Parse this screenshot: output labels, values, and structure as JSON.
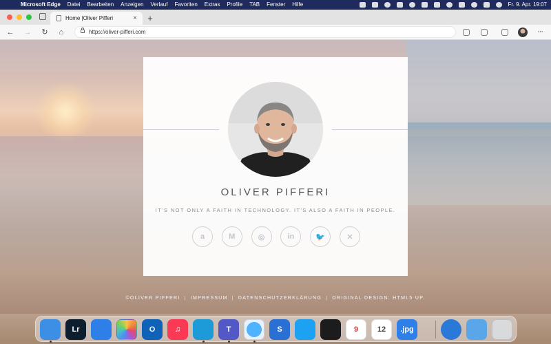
{
  "menubar": {
    "app_name": "Microsoft Edge",
    "items": [
      "Datei",
      "Bearbeiten",
      "Anzeigen",
      "Verlauf",
      "Favoriten",
      "Extras",
      "Profile",
      "TAB",
      "Fenster",
      "Hilfe"
    ],
    "clock": "Fr. 9. Apr.  19:07"
  },
  "browser": {
    "tab_title": "Home |Oliver Pifferi",
    "tab_close": "×",
    "new_tab": "+",
    "url": "https://oliver-pifferi.com"
  },
  "page": {
    "name": "OLIVER PIFFERI",
    "tagline": "It's not only a faith in technology. It's also a faith in people.",
    "socials": [
      {
        "icon": "amazon-icon",
        "glyph": "a"
      },
      {
        "icon": "medium-icon",
        "glyph": "M"
      },
      {
        "icon": "instagram-icon",
        "glyph": "◎"
      },
      {
        "icon": "linkedin-icon",
        "glyph": "in"
      },
      {
        "icon": "twitter-icon",
        "glyph": "🐦"
      },
      {
        "icon": "xing-icon",
        "glyph": "✕"
      }
    ],
    "footer": {
      "copyright": "©OLIVER PIFFERI",
      "impressum": "IMPRESSUM",
      "datenschutz": "DATENSCHUTZERKLÄRUNG",
      "design": "ORIGINAL DESIGN: HTML5 UP."
    }
  },
  "dock": {
    "items": [
      {
        "name": "finder",
        "label": "",
        "color": "#3d8fe6"
      },
      {
        "name": "lightroom",
        "label": "Lr",
        "color": "#0d1f2f"
      },
      {
        "name": "bookmarks",
        "label": "",
        "color": "#2f7fe8"
      },
      {
        "name": "photos",
        "label": "",
        "color": "#ffffff"
      },
      {
        "name": "outlook",
        "label": "O",
        "color": "#0f62b8"
      },
      {
        "name": "music",
        "label": "♫",
        "color": "#fa3a55"
      },
      {
        "name": "edge",
        "label": "",
        "color": "#1d9bd8"
      },
      {
        "name": "teams",
        "label": "T",
        "color": "#5259c7"
      },
      {
        "name": "safari",
        "label": "",
        "color": "#ffffff"
      },
      {
        "name": "scrivener",
        "label": "S",
        "color": "#2a6fd3"
      },
      {
        "name": "twitter",
        "label": "",
        "color": "#1da1f2"
      },
      {
        "name": "tes",
        "label": "",
        "color": "#1c1c1c"
      },
      {
        "name": "pages-9",
        "label": "9",
        "color": "#ffffff"
      },
      {
        "name": "numbers-12",
        "label": "12",
        "color": "#ffffff"
      },
      {
        "name": "jpg",
        "label": ".jpg",
        "color": "#2f7fe8"
      },
      {
        "name": "globe",
        "label": "",
        "color": "#2a79d8"
      },
      {
        "name": "downloads",
        "label": "",
        "color": "#5aa6e8"
      },
      {
        "name": "trash",
        "label": "",
        "color": "#d9dadc"
      }
    ]
  }
}
